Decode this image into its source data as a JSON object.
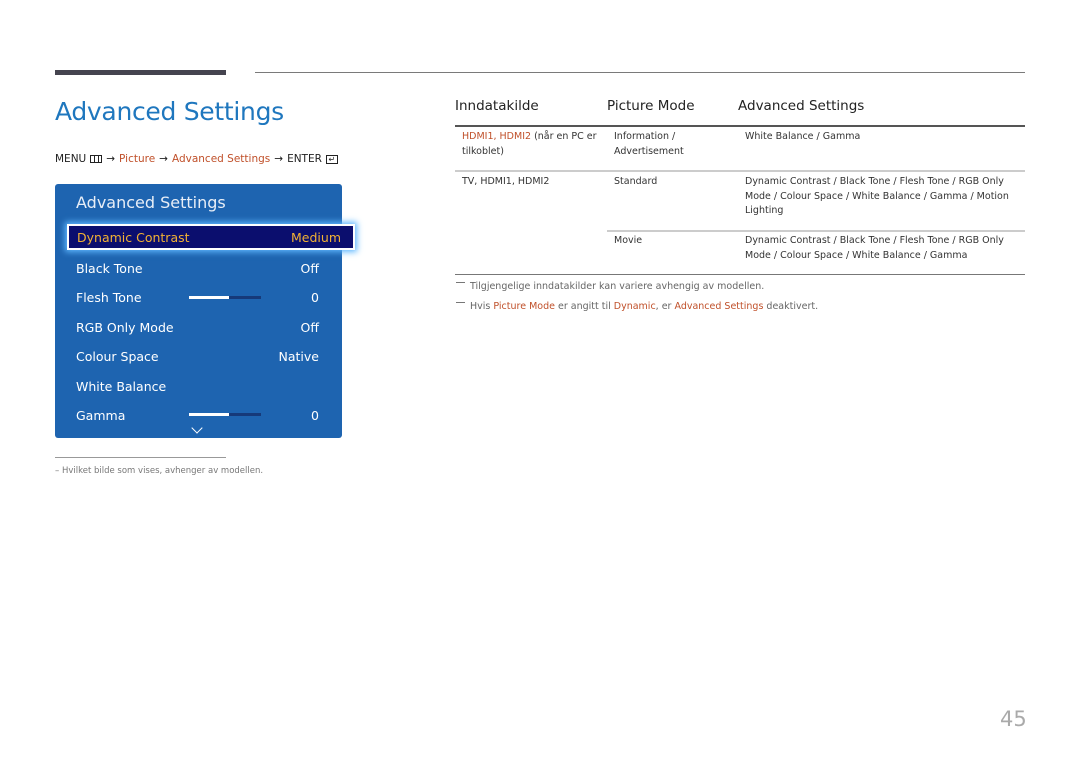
{
  "page": {
    "title": "Advanced Settings",
    "page_number": "45"
  },
  "menu_path": {
    "menu_label": "MENU",
    "arrow": "→",
    "step1": "Picture",
    "step2": "Advanced Settings",
    "enter_label": "ENTER",
    "menu_icon": "menu-grid-icon",
    "enter_icon": "enter-icon"
  },
  "osd": {
    "title": "Advanced Settings",
    "items": [
      {
        "label": "Dynamic Contrast",
        "value": "Medium",
        "selected": true
      },
      {
        "label": "Black Tone",
        "value": "Off"
      },
      {
        "label": "Flesh Tone",
        "value": "0",
        "slider_fraction": 0.55
      },
      {
        "label": "RGB Only Mode",
        "value": "Off"
      },
      {
        "label": "Colour Space",
        "value": "Native"
      },
      {
        "label": "White Balance",
        "value": ""
      },
      {
        "label": "Gamma",
        "value": "0",
        "slider_fraction": 0.55
      }
    ],
    "more_icon": "chevron-down-icon",
    "colors": {
      "panel": "#1e64b0",
      "selected_bg": "#0b0e6e",
      "selected_text": "#f2b134"
    }
  },
  "footnote": "–  Hvilket bilde som vises, avhenger av modellen.",
  "table": {
    "headers": [
      "Inndatakilde",
      "Picture Mode",
      "Advanced Settings"
    ],
    "rows": [
      {
        "source": {
          "red": "HDMI1, HDMI2",
          "rest": " (når en PC er tilkoblet)"
        },
        "mode": "Information / Advertisement",
        "settings": "White Balance / Gamma"
      },
      {
        "source": {
          "red": "TV, HDMI1, HDMI2",
          "rest": ""
        },
        "mode": "Standard",
        "settings": "Dynamic Contrast / Black Tone / Flesh Tone / RGB Only Mode / Colour Space / White Balance / Gamma / Motion Lighting"
      },
      {
        "source": {
          "red": "",
          "rest": ""
        },
        "mode": "Movie",
        "settings": "Dynamic Contrast / Black Tone / Flesh Tone / RGB Only Mode / Colour Space / White Balance / Gamma"
      }
    ]
  },
  "notes": {
    "note1": "Tilgjengelige inndatakilder kan variere avhengig av modellen.",
    "note2": {
      "p1": "Hvis ",
      "r1": "Picture Mode",
      "p2": " er angitt til ",
      "r2": "Dynamic",
      "p3": ", er ",
      "r3": "Advanced Settings",
      "p4": " deaktivert."
    }
  },
  "colors": {
    "accent_blue": "#1f77be",
    "link_red": "#c0502a"
  }
}
